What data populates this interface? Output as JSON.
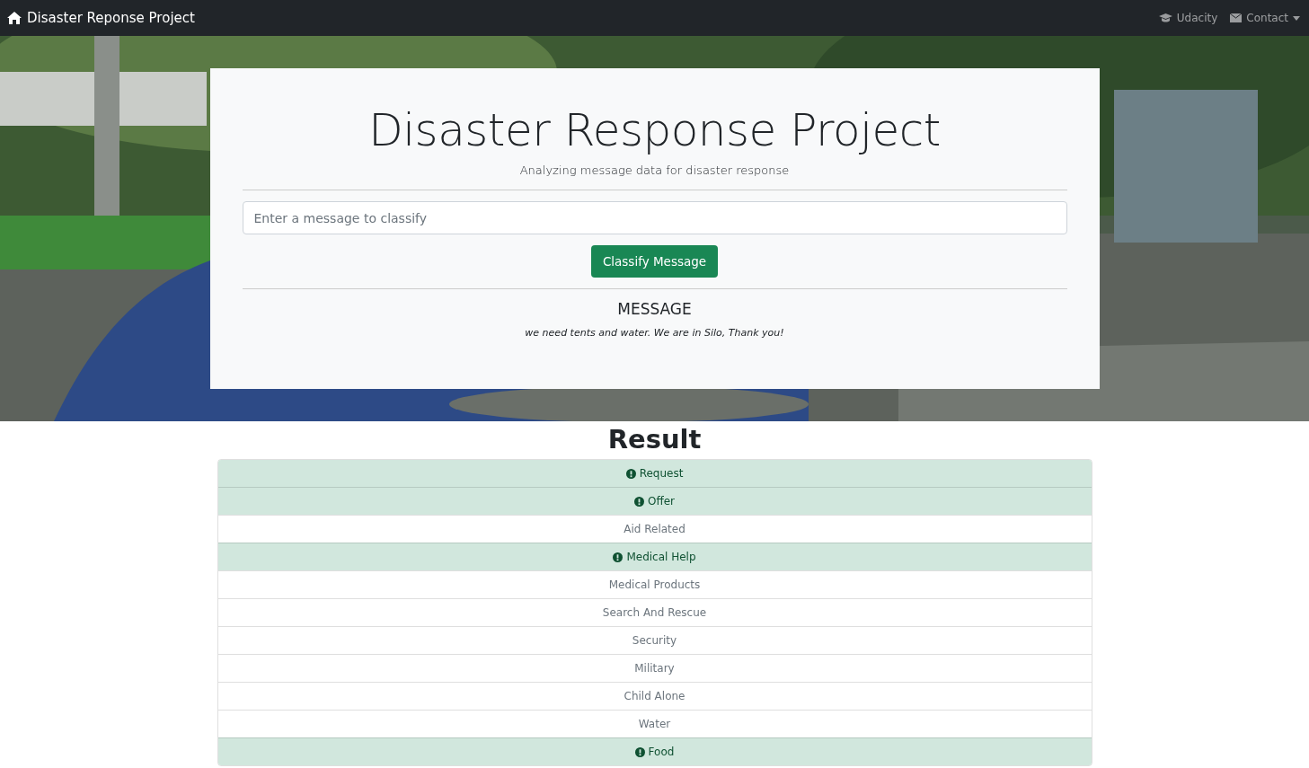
{
  "navbar": {
    "brand": "Disaster Reponse Project",
    "links": [
      {
        "label": "Udacity",
        "kind": "link"
      },
      {
        "label": "Contact",
        "kind": "dropdown"
      }
    ]
  },
  "hero": {
    "title": "Disaster Response Project",
    "subtitle": "Analyzing message data for disaster response",
    "input": {
      "placeholder": "Enter a message to classify"
    },
    "button": "Classify Message",
    "message_heading": "MESSAGE",
    "message": "we need tents and water. We are in Silo, Thank you!"
  },
  "result": {
    "title": "Result",
    "categories": [
      {
        "label": "Request",
        "flagged": true
      },
      {
        "label": "Offer",
        "flagged": true
      },
      {
        "label": "Aid Related",
        "flagged": false
      },
      {
        "label": "Medical Help",
        "flagged": true
      },
      {
        "label": "Medical Products",
        "flagged": false
      },
      {
        "label": "Search And Rescue",
        "flagged": false
      },
      {
        "label": "Security",
        "flagged": false
      },
      {
        "label": "Military",
        "flagged": false
      },
      {
        "label": "Child Alone",
        "flagged": false
      },
      {
        "label": "Water",
        "flagged": false
      },
      {
        "label": "Food",
        "flagged": true
      }
    ]
  }
}
